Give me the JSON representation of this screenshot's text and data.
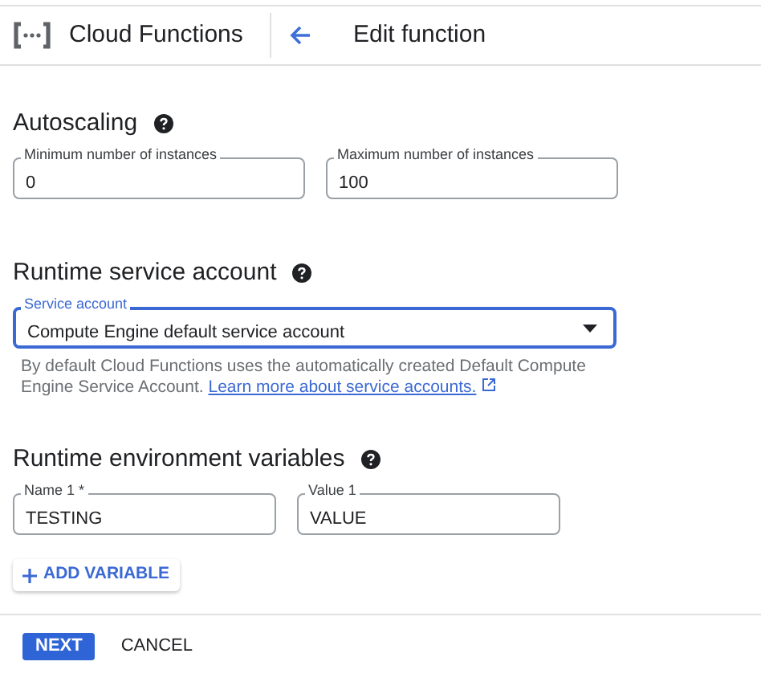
{
  "header": {
    "product": "Cloud Functions",
    "page_title": "Edit function"
  },
  "sections": [
    {
      "title": "Autoscaling",
      "fields": [
        {
          "kind": "text",
          "label": "Minimum number of instances",
          "value": "0",
          "focused": false
        },
        {
          "kind": "text",
          "label": "Maximum number of instances",
          "value": "100",
          "focused": false
        }
      ]
    },
    {
      "title": "Runtime service account",
      "fields": [
        {
          "kind": "select",
          "label": "Service account",
          "value": "Compute Engine default service account",
          "focused": true
        }
      ],
      "help": "By default Cloud Functions uses the automatically created Default Compute Engine Service Account.",
      "help_link": "Learn more about service accounts."
    },
    {
      "title": "Runtime environment variables",
      "fields": [
        {
          "kind": "text",
          "label": "Name 1 *",
          "value": "TESTING",
          "focused": false
        },
        {
          "kind": "text",
          "label": "Value 1",
          "value": "VALUE",
          "focused": false
        }
      ],
      "add_button": "ADD VARIABLE"
    }
  ],
  "footer": {
    "primary": "NEXT",
    "secondary": "CANCEL"
  }
}
